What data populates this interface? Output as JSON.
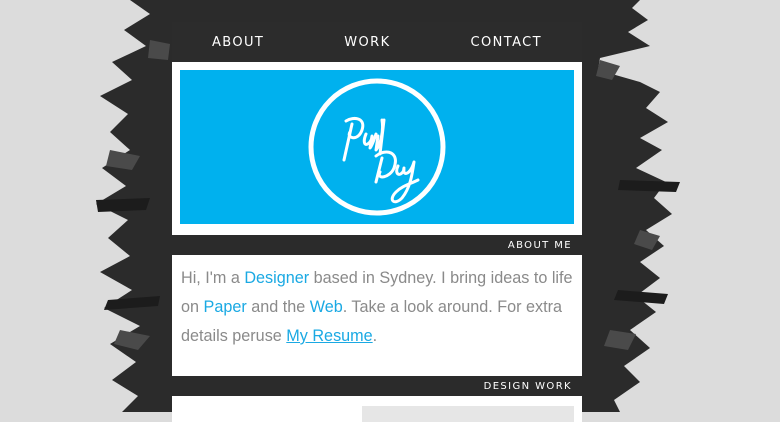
{
  "nav": {
    "items": [
      {
        "label": "ABOUT"
      },
      {
        "label": "WORK"
      },
      {
        "label": "CONTACT"
      }
    ]
  },
  "hero": {
    "background": "#00b1ee",
    "logo": {
      "text_line1": "Paul",
      "text_line2": "Day",
      "icon": "signature-logo-icon"
    }
  },
  "about": {
    "heading": "ABOUT ME",
    "text_intro": "Hi, I'm a ",
    "link_designer": "Designer",
    "text_mid1": " based in Sydney. I bring ideas to life on ",
    "link_paper": "Paper",
    "text_mid2": " and the ",
    "link_web": "Web",
    "text_mid3": ". Take a look around. For extra details peruse ",
    "link_resume": "My Resume",
    "text_end": "."
  },
  "work": {
    "heading": "DESIGN WORK"
  },
  "colors": {
    "accent": "#00b1ee",
    "nav_bg": "#2c2c2c",
    "link": "#1aa9e3",
    "body_text": "#8a8a8a"
  }
}
